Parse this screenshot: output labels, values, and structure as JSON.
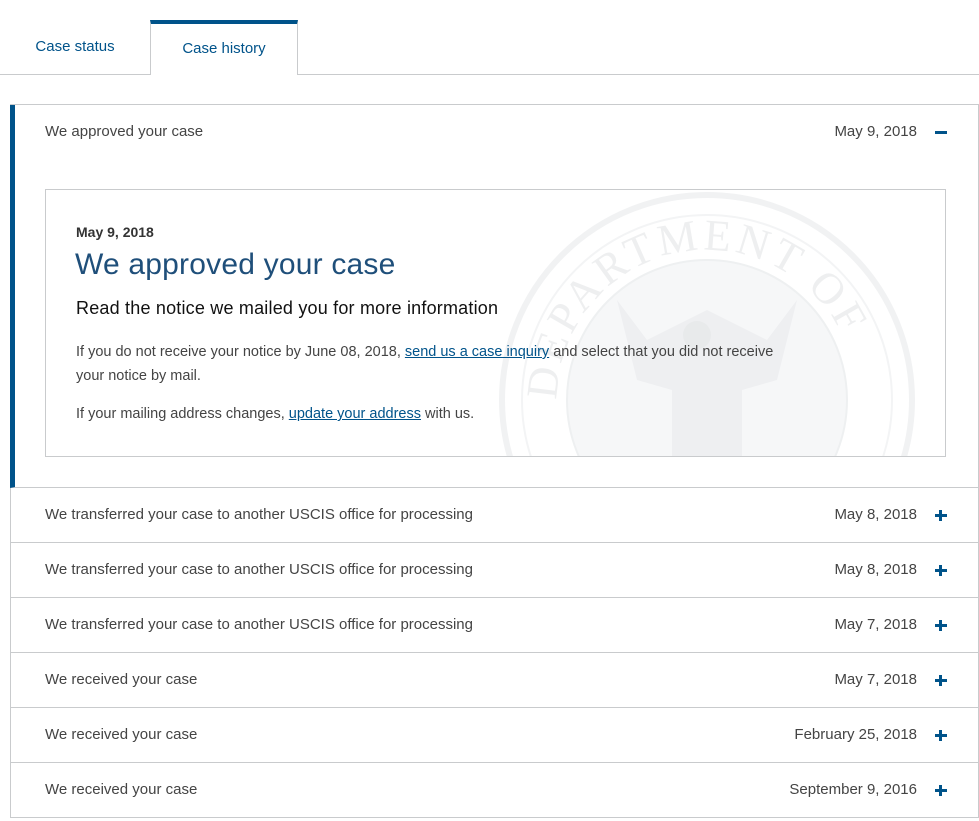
{
  "tabs": {
    "case_status": "Case status",
    "case_history": "Case history",
    "active": "Case history"
  },
  "expanded": {
    "title": "We approved your case",
    "date": "May 9, 2018",
    "toggle": "minus-icon",
    "card": {
      "date": "May 9, 2018",
      "title": "We approved your case",
      "subtitle": "Read the notice we mailed you for more information",
      "p1_before": "If you do not receive your notice by June 08, 2018, ",
      "p1_link": "send us a case inquiry",
      "p1_after": " and select that you did not receive your notice by mail.",
      "p2_before": "If your mailing address changes, ",
      "p2_link": "update your address",
      "p2_after": " with us."
    }
  },
  "history": [
    {
      "title": "We transferred your case to another USCIS office for processing",
      "date": "May 8, 2018"
    },
    {
      "title": "We transferred your case to another USCIS office for processing",
      "date": "May 8, 2018"
    },
    {
      "title": "We transferred your case to another USCIS office for processing",
      "date": "May 7, 2018"
    },
    {
      "title": "We received your case",
      "date": "May 7, 2018"
    },
    {
      "title": "We received your case",
      "date": "February 25, 2018"
    },
    {
      "title": "We received your case",
      "date": "September 9, 2016"
    }
  ],
  "colors": {
    "accent": "#00538a",
    "heading": "#1f4f7a",
    "border": "#c9cbcd"
  },
  "seal": {
    "text": "DEPARTMENT OF"
  }
}
